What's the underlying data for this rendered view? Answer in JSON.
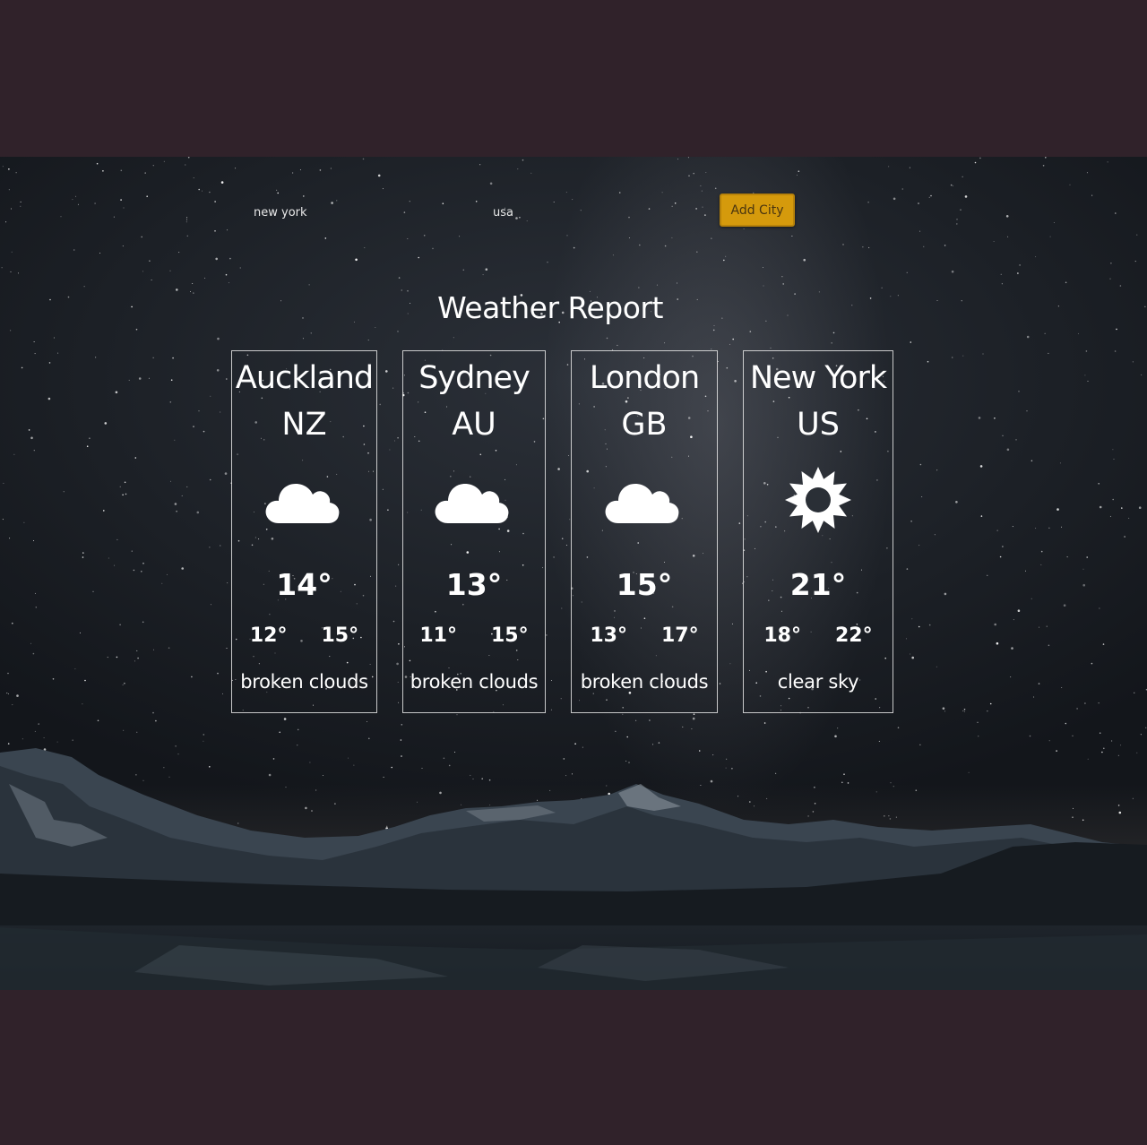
{
  "form": {
    "city_value": "new york",
    "country_value": "usa",
    "add_button_label": "Add City"
  },
  "page": {
    "title": "Weather Report"
  },
  "cards": [
    {
      "city": "Auckland",
      "country": "NZ",
      "icon": "cloud-icon",
      "temp": "14°",
      "min": "12°",
      "max": "15°",
      "description": "broken clouds"
    },
    {
      "city": "Sydney",
      "country": "AU",
      "icon": "cloud-icon",
      "temp": "13°",
      "min": "11°",
      "max": "15°",
      "description": "broken clouds"
    },
    {
      "city": "London",
      "country": "GB",
      "icon": "cloud-icon",
      "temp": "15°",
      "min": "13°",
      "max": "17°",
      "description": "broken clouds"
    },
    {
      "city": "New York",
      "country": "US",
      "icon": "sun-icon",
      "temp": "21°",
      "min": "18°",
      "max": "22°",
      "description": "clear sky"
    }
  ],
  "colors": {
    "page_background": "#30222a",
    "button_accent": "#d59a0c",
    "text": "#ffffff"
  }
}
